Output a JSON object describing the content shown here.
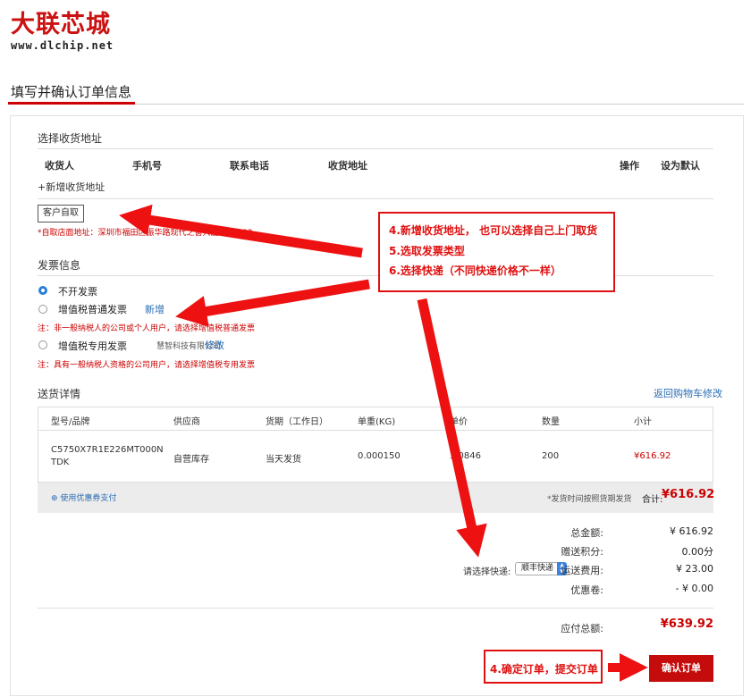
{
  "logo": {
    "main": "大联芯城",
    "url": "www.dlchip.net"
  },
  "page_title": "填写并确认订单信息",
  "address": {
    "heading": "选择收货地址",
    "columns": [
      "收货人",
      "手机号",
      "联系电话",
      "收货地址",
      "操作",
      "设为默认"
    ],
    "add_link": "+新增收货地址",
    "pickup_button": "客户自取",
    "pickup_note": "*自取店面地址：深圳市福田区振华路现代之窗大厦A座1003"
  },
  "invoice": {
    "heading": "发票信息",
    "options": [
      {
        "label": "不开发票",
        "selected": true
      },
      {
        "label": "增值税普通发票",
        "selected": false,
        "action": "新增"
      },
      {
        "label": "增值税专用发票",
        "selected": false,
        "company": "慧智科技有限公司",
        "action": "修改"
      }
    ],
    "note_normal": "注：非一般纳税人的公司或个人用户，请选择增值税普通发票",
    "note_special": "注：具有一般纳税人资格的公司用户，请选择增值税专用发票"
  },
  "delivery": {
    "heading": "送货详情",
    "back_link": "返回购物车修改",
    "columns": [
      "型号/品牌",
      "供应商",
      "货期（工作日）",
      "单重(KG)",
      "单价",
      "数量",
      "小计"
    ],
    "row": {
      "model": "C5750X7R1E226MT000N",
      "brand": "TDK",
      "supplier": "自营库存",
      "lead_time": "当天发货",
      "unit_weight": "0.000150",
      "unit_price": "3.0846",
      "quantity": "200",
      "subtotal": "¥616.92"
    },
    "coupon_link": "使用优惠券支付",
    "ship_note": "*发货时间按照货期发货",
    "total_label": "合计:",
    "total_value": "¥616.92"
  },
  "summary": {
    "total_label": "总金额:",
    "total_value": "¥ 616.92",
    "points_label": "赠送积分:",
    "points_value": "0.00分",
    "courier_prompt": "请选择快递:",
    "courier_selected": "顺丰快递",
    "shipping_label": "运送费用:",
    "shipping_value": "¥ 23.00",
    "coupon_label": "优惠卷:",
    "coupon_value": "- ¥ 0.00",
    "payable_label": "应付总额:",
    "payable_value": "¥639.92",
    "confirm_button": "确认订单"
  },
  "annotations": {
    "callout1_lines": [
      "4.新增收货地址， 也可以选择自己上门取货",
      "5.选取发票类型",
      "6.选择快递（不同快递价格不一样）"
    ],
    "callout2": "4.确定订单，提交订单"
  },
  "colors": {
    "brand_red": "#cc1111",
    "link_blue": "#2a6db3",
    "annotation_red": "#e01010"
  }
}
